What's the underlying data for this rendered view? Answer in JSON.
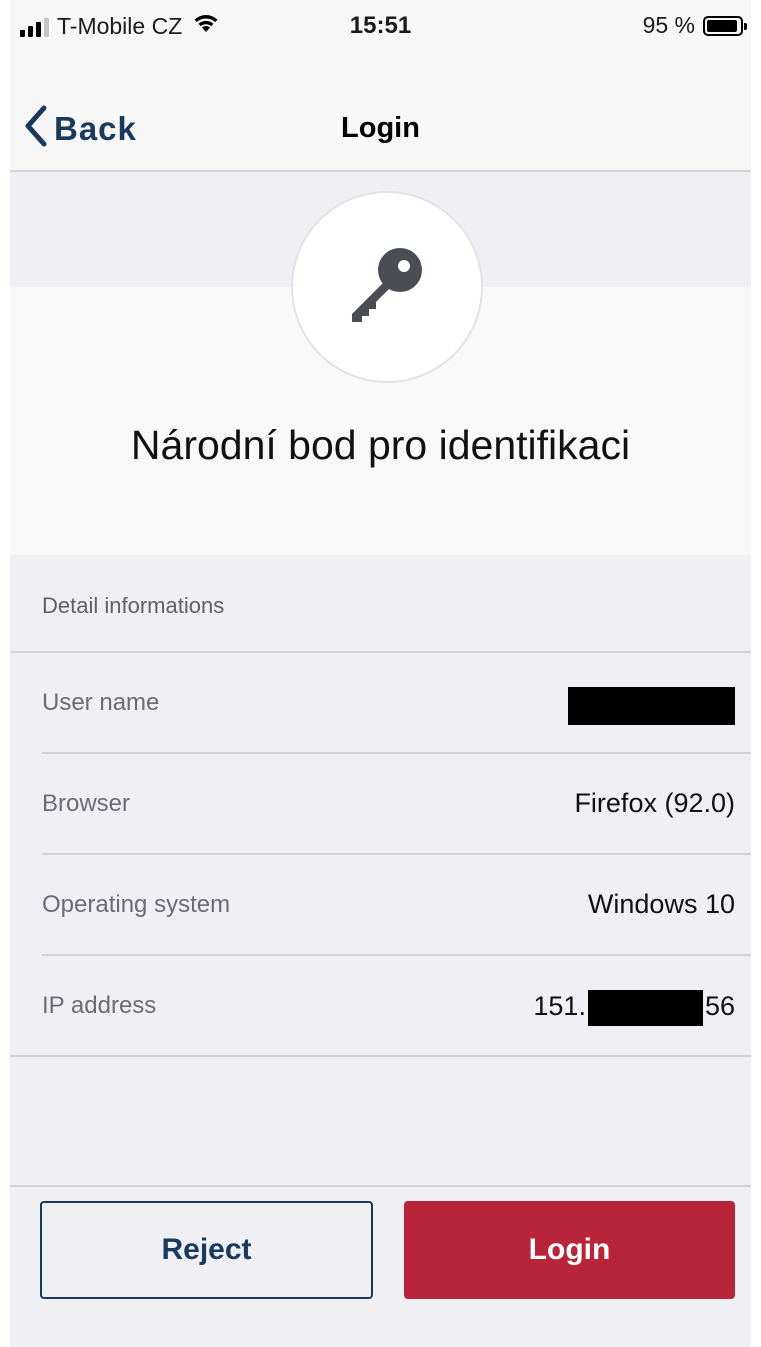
{
  "status_bar": {
    "carrier": "T-Mobile CZ",
    "time": "15:51",
    "battery": "95 %"
  },
  "nav": {
    "back_label": "Back",
    "title": "Login"
  },
  "hero": {
    "icon": "key-icon",
    "service_name": "Národní bod pro identifikaci"
  },
  "details": {
    "header": "Detail informations",
    "rows": [
      {
        "label": "User name",
        "value": ""
      },
      {
        "label": "Browser",
        "value": "Firefox (92.0)"
      },
      {
        "label": "Operating system",
        "value": "Windows 10"
      },
      {
        "label": "IP address",
        "value_prefix": "151.",
        "value_suffix": "56"
      }
    ]
  },
  "actions": {
    "reject_label": "Reject",
    "login_label": "Login"
  },
  "colors": {
    "accent_navy": "#1a3a5c",
    "login_red": "#b8243a",
    "background": "#efeff4"
  }
}
